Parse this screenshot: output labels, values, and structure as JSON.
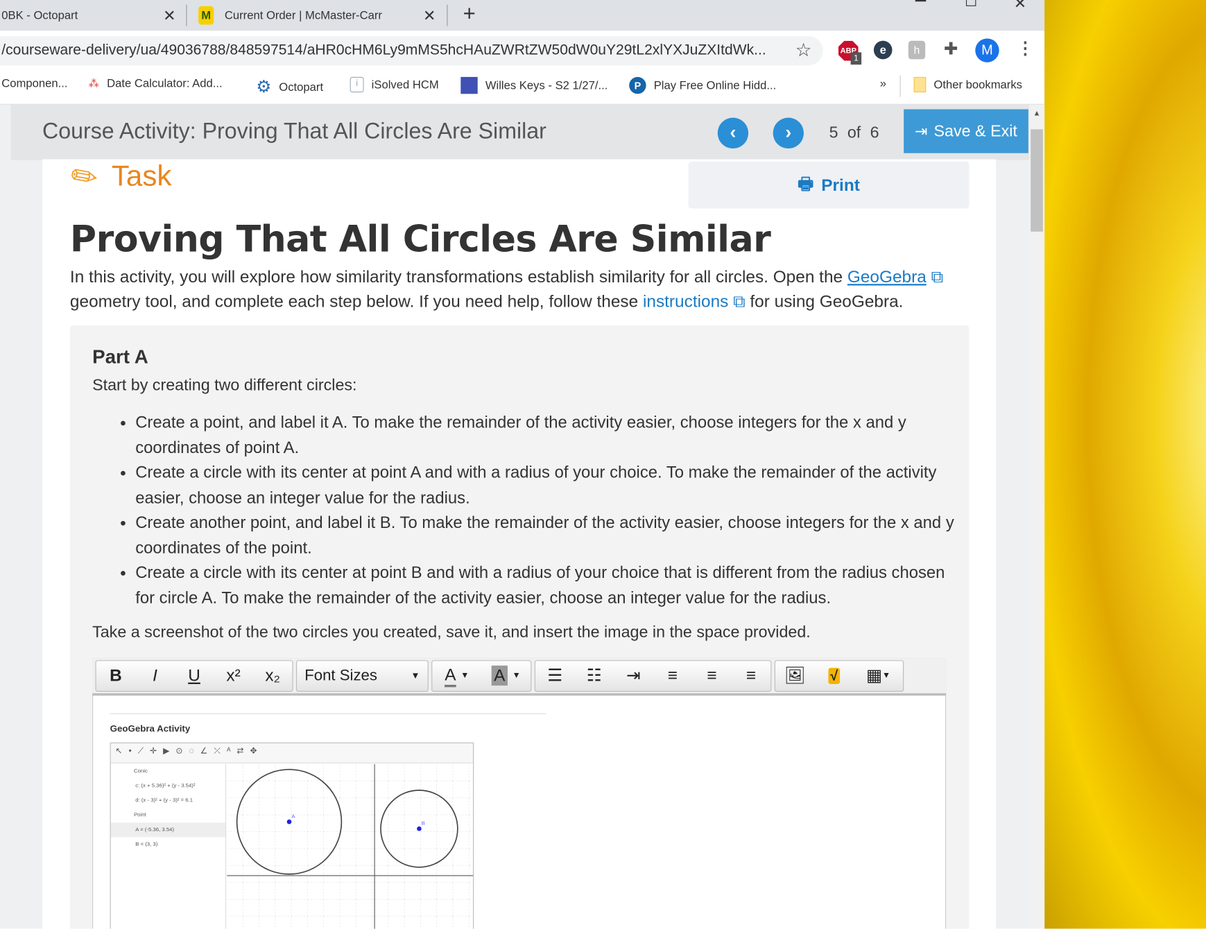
{
  "browser": {
    "tabs": [
      {
        "label": "0BK - Octopart",
        "icon": "octopart-icon"
      },
      {
        "label": "Current Order | McMaster-Carr",
        "icon": "mcmaster-icon"
      }
    ],
    "new_tab": "+",
    "url": "/courseware-delivery/ua/49036788/848597514/aHR0cHM6Ly9mMS5hcHAuZWRtZW50dW0uY29tL2xlYXJuZXItdWk...",
    "abp_badge": "1",
    "avatar": "M",
    "bookmarks": [
      {
        "label": "Componen..."
      },
      {
        "label": "Date Calculator: Add..."
      },
      {
        "label": "Octopart"
      },
      {
        "label": "iSolved HCM"
      },
      {
        "label": "Willes Keys - S2 1/27/..."
      },
      {
        "label": "Play Free Online Hidd..."
      }
    ],
    "more": "»",
    "other_bookmarks": "Other bookmarks"
  },
  "header": {
    "title": "Course Activity: Proving That All Circles Are Similar",
    "page": "5",
    "of": "of",
    "total": "6",
    "save_label": "Save & Exit"
  },
  "task": {
    "label": "Task",
    "print": "Print"
  },
  "main": {
    "title": "Proving That All Circles Are Similar",
    "intro_1": "In this activity, you will explore how similarity transformations establish similarity for all circles. Open the ",
    "geogebra_link": "GeoGebra",
    "intro_2": " geometry tool, and complete each step below. If you need help, follow these ",
    "instructions_link": "instructions",
    "intro_3": " for using GeoGebra.",
    "part_a": {
      "heading": "Part A",
      "lead": "Start by creating two different circles:",
      "bullets": [
        "Create a point, and label it A. To make the remainder of the activity easier, choose integers for the x and y coordinates of point A.",
        "Create a circle with its center at point A and with a radius of your choice. To make the remainder of the activity easier, choose an integer value for the radius.",
        "Create another point, and label it B. To make the remainder of the activity easier, choose integers for the x and y coordinates of the point.",
        "Create a circle with its center at point B and with a radius of your choice that is different from the radius chosen for circle A. To make the remainder of the activity easier, choose an integer value for the radius."
      ],
      "screenshot_instruction": "Take a screenshot of the two circles you created, save it, and insert the image in the space provided."
    }
  },
  "editor": {
    "bold": "B",
    "italic": "I",
    "underline": "U",
    "font_sizes": "Font Sizes",
    "text_color": "A",
    "bg_color": "A"
  },
  "geogebra": {
    "title": "GeoGebra Activity",
    "conic_label": "Conic",
    "point_label": "Point",
    "eq_c": "c: (x + 5.36)² + (y - 3.54)²",
    "eq_d": "d: (x - 3)² + (y - 3)² = 6.1",
    "point_a": "A = (-5.36, 3.54)",
    "point_b": "B = (3, 3)",
    "label_a": "A",
    "label_b": "B"
  },
  "colors": {
    "accent": "#2a8fd6",
    "task": "#e8871e",
    "link": "#1b7ac4"
  }
}
